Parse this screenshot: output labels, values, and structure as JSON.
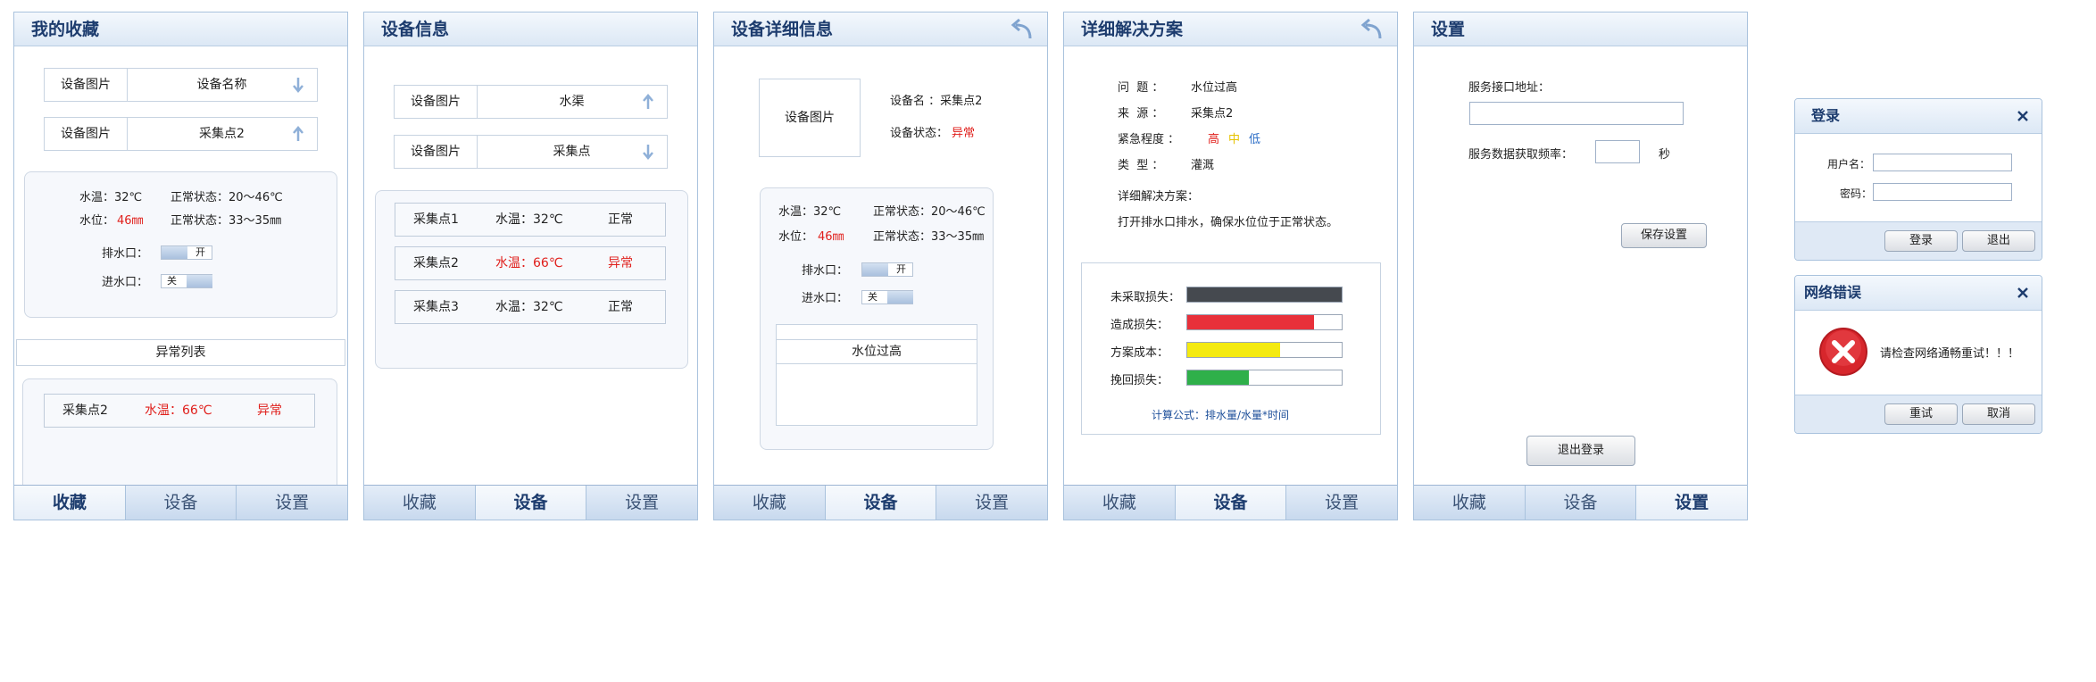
{
  "favorites": {
    "title": "我的收藏",
    "rows": [
      {
        "image": "设备图片",
        "name": "设备名称"
      },
      {
        "image": "设备图片",
        "name": "采集点2"
      }
    ],
    "status": {
      "water_temp": "水温：32℃",
      "temp_normal": "正常状态：20～46℃",
      "water_level_label": "水位：",
      "water_level_value": "46㎜",
      "level_normal": "正常状态：33～35㎜",
      "outlet_label": "排水口：",
      "outlet_state": "开",
      "inlet_label": "进水口：",
      "inlet_state": "关"
    },
    "abnormal_title": "异常列表",
    "abnormal_row": {
      "point": "采集点2",
      "temp": "水温：66℃",
      "state": "异常"
    }
  },
  "tabs": [
    "收藏",
    "设备",
    "设置"
  ],
  "devices": {
    "title": "设备信息",
    "rows": [
      {
        "image": "设备图片",
        "name": "水渠"
      },
      {
        "image": "设备图片",
        "name": "采集点"
      }
    ],
    "points": [
      {
        "point": "采集点1",
        "temp": "水温：32℃",
        "state": "正常"
      },
      {
        "point": "采集点2",
        "temp": "水温：66℃",
        "state": "异常"
      },
      {
        "point": "采集点3",
        "temp": "水温：32℃",
        "state": "正常"
      }
    ]
  },
  "detail": {
    "title": "设备详细信息",
    "image_label": "设备图片",
    "name_line": "设备名 ：采集点2",
    "status_label": "设备状态：",
    "status_value": "异常",
    "water_temp": "水温：32℃",
    "temp_normal": "正常状态：20～46℃",
    "water_level_label": "水位：",
    "water_level_value": "46㎜",
    "level_normal": "正常状态：33～35㎜",
    "outlet_label": "排水口：",
    "outlet_state": "开",
    "inlet_label": "进水口：",
    "inlet_state": "关",
    "alert": "水位过高"
  },
  "solution": {
    "title": "详细解决方案",
    "problem_label": "问  题 ：",
    "problem": "水位过高",
    "source_label": "来  源 ：",
    "source": "采集点2",
    "urgency_label": "紧急程度 ：",
    "urgency_high": "高",
    "urgency_mid": "中",
    "urgency_low": "低",
    "type_label": "类  型 ：",
    "type": "灌溉",
    "plan_label": "详细解决方案：",
    "plan": "打开排水口排水，确保水位位于正常状态。",
    "bars": [
      {
        "label": "未采取损失：",
        "level": 1.0,
        "color": "#45494f"
      },
      {
        "label": "造成损失：",
        "level": 0.82,
        "color": "#e8303a"
      },
      {
        "label": "方案成本：",
        "level": 0.6,
        "color": "#f4ea10"
      },
      {
        "label": "挽回损失：",
        "level": 0.4,
        "color": "#2fb04a"
      }
    ],
    "formula": "计算公式：排水量/水量*时间"
  },
  "settings": {
    "title": "设置",
    "address_label": "服务接口地址：",
    "frequency_label": "服务数据获取频率：",
    "seconds_unit": "秒",
    "save_button": "保存设置",
    "logout_button": "退出登录"
  },
  "login_dialog": {
    "title": "登录",
    "username_label": "用户名：",
    "password_label": "密码：",
    "login_button": "登录",
    "exit_button": "退出"
  },
  "error_dialog": {
    "title": "网络错误",
    "message": "请检查网络通畅重试！！！",
    "retry_button": "重试",
    "cancel_button": "取消"
  }
}
